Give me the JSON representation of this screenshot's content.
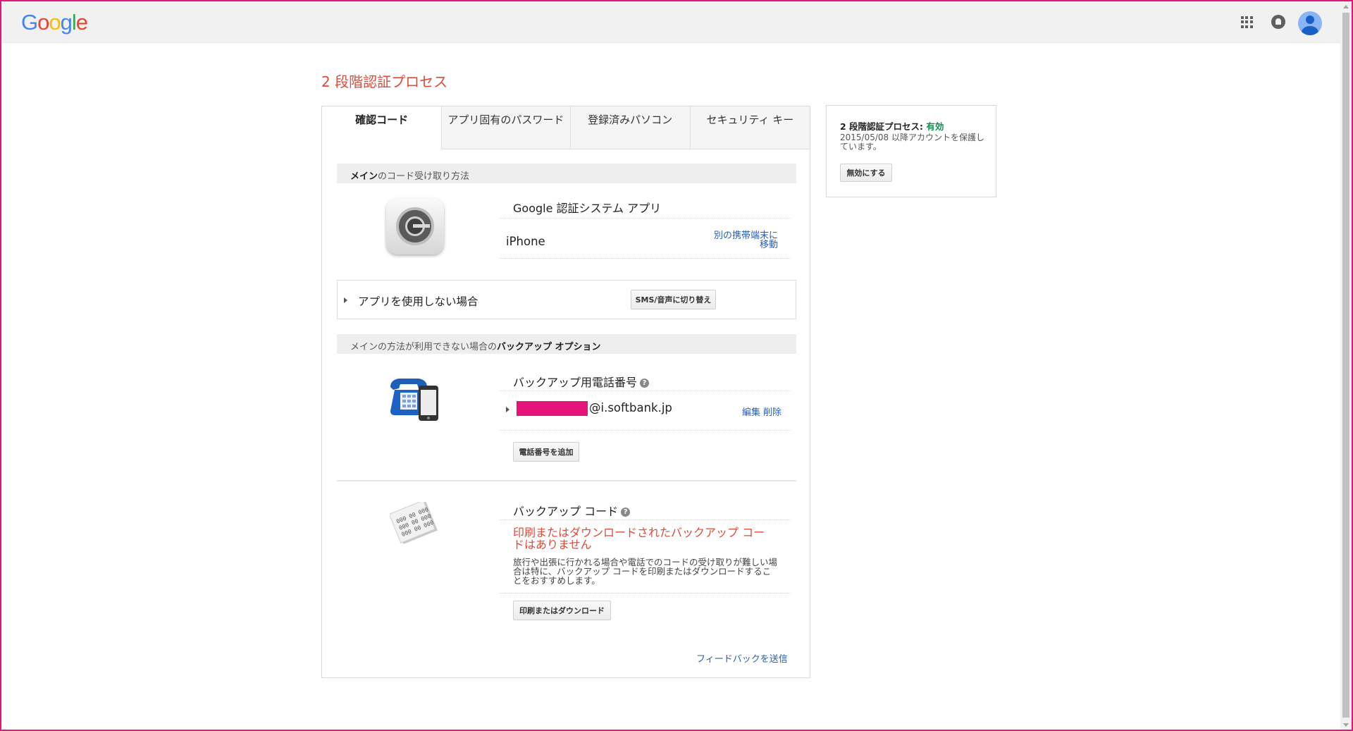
{
  "header": {
    "logo_letters": [
      {
        "ch": "G",
        "color": "#4285f4"
      },
      {
        "ch": "o",
        "color": "#ea4335"
      },
      {
        "ch": "o",
        "color": "#fbbc05"
      },
      {
        "ch": "g",
        "color": "#4285f4"
      },
      {
        "ch": "l",
        "color": "#34a853"
      },
      {
        "ch": "e",
        "color": "#ea4335"
      }
    ],
    "icons": [
      "apps-icon",
      "bell-icon",
      "avatar"
    ]
  },
  "page": {
    "title": "2 段階認証プロセス"
  },
  "tabs": [
    {
      "label": "確認コード",
      "active": true
    },
    {
      "label": "アプリ固有のパスワード",
      "active": false
    },
    {
      "label": "登録済みパソコン",
      "active": false
    },
    {
      "label": "セキュリティ キー",
      "active": false
    }
  ],
  "primary": {
    "section_label_bold": "メイン",
    "section_label_rest": "のコード受け取り方法",
    "app_name": "Google 認証システム アプリ",
    "device": "iPhone",
    "move_link_line1": "別の携帯端末に",
    "move_link_line2": "移動",
    "no_app_label": "アプリを使用しない場合",
    "switch_button": "SMS/音声に切り替え"
  },
  "backup": {
    "section_label_rest": "メインの方法が利用できない場合の",
    "section_label_bold": "バックアップ オプション",
    "phone_title": "バックアップ用電話番号",
    "phone_value": "@i.softbank.jp",
    "edit_link": "編集",
    "delete_link": "削除",
    "add_phone_button": "電話番号を追加",
    "codes_title": "バックアップ コード",
    "codes_warning": "印刷またはダウンロードされたバックアップ コードはありません",
    "codes_desc": "旅行や出張に行かれる場合や電話でのコードの受け取りが難しい場合は特に、バックアップ コードを印刷またはダウンロードすることをおすすめします。",
    "print_button": "印刷またはダウンロード",
    "codes_icon_lines": [
      "000 00 000",
      "000 00 000",
      "000 00 000"
    ]
  },
  "feedback_link": "フィードバックを送信",
  "side": {
    "title_prefix": "2 段階認証プロセス: ",
    "status": "有効",
    "desc": "2015/05/08 以降アカウントを保護しています。",
    "disable_button": "無効にする"
  },
  "colors": {
    "title_red": "#dd4b39",
    "link_blue": "#2a5db0",
    "status_green": "#0d904f",
    "frame_magenta": "#e5137a"
  }
}
